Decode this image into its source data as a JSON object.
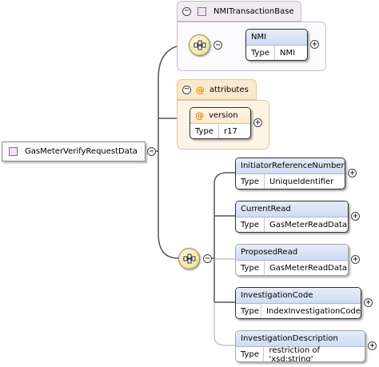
{
  "root": {
    "name": "GasMeterVerifyRequestData"
  },
  "base_group": {
    "title": "NMITransactionBase",
    "element": {
      "name": "NMI",
      "type_label": "Type",
      "type": "NMI"
    }
  },
  "attributes_group": {
    "title": "attributes",
    "attribute": {
      "name": "version",
      "type_label": "Type",
      "type": "r17"
    }
  },
  "sequence": {
    "children": [
      {
        "name": "InitiatorReferenceNumber",
        "type_label": "Type",
        "type": "UniqueIdentifier",
        "optional": false
      },
      {
        "name": "CurrentRead",
        "type_label": "Type",
        "type": "GasMeterReadData",
        "optional": false
      },
      {
        "name": "ProposedRead",
        "type_label": "Type",
        "type": "GasMeterReadData",
        "optional": true
      },
      {
        "name": "InvestigationCode",
        "type_label": "Type",
        "type": "IndexInvestigationCode",
        "optional": false
      },
      {
        "name": "InvestigationDescription",
        "type_label": "Type",
        "type": "restriction of 'xsd:string'",
        "optional": true
      }
    ]
  },
  "icons": {
    "collapse": "−",
    "expand": "+",
    "attribute": "@"
  }
}
